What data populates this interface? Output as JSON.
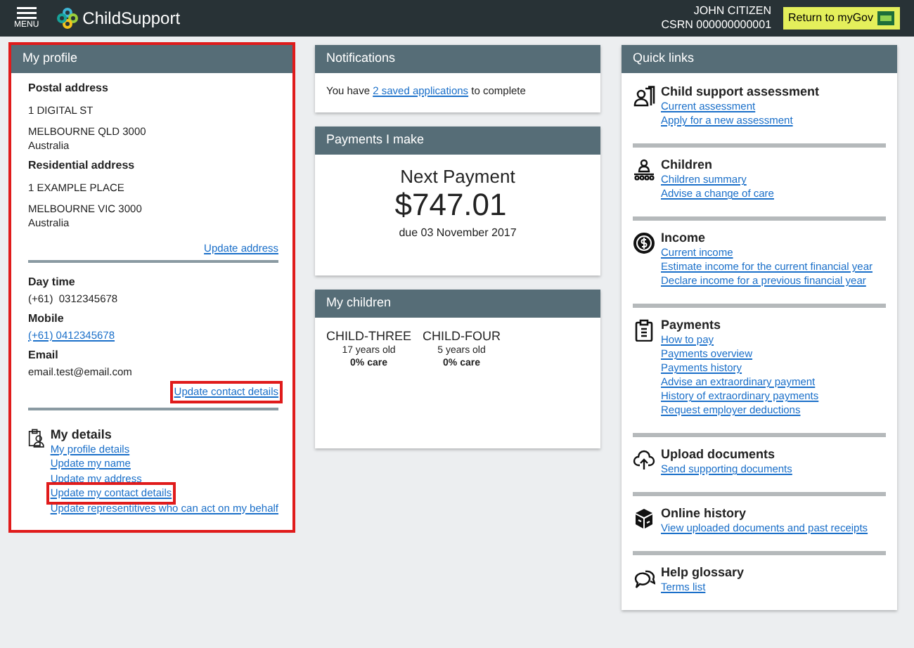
{
  "header": {
    "menu_label": "MENU",
    "brand": "ChildSupport",
    "user_name": "JOHN CITIZEN",
    "csrn": "CSRN 000000000001",
    "return_button": "Return to myGov"
  },
  "profile": {
    "title": "My profile",
    "highlighted": true,
    "postal": {
      "label": "Postal address",
      "lines": [
        "1 DIGITAL ST",
        "MELBOURNE QLD 3000",
        "Australia"
      ]
    },
    "residential": {
      "label": "Residential address",
      "lines": [
        "1 EXAMPLE PLACE",
        "MELBOURNE VIC 3000",
        "Australia"
      ]
    },
    "update_address": {
      "text": "Update address"
    },
    "contacts": [
      {
        "label": "Day time",
        "value": "(+61)  0312345678",
        "kind": "text"
      },
      {
        "label": "Mobile",
        "value": "(+61) 0412345678",
        "kind": "link"
      },
      {
        "label": "Email",
        "value": "email.test@email.com",
        "kind": "text"
      }
    ],
    "update_contact": {
      "text": "Update contact details",
      "highlighted": true
    },
    "my_details": {
      "title": "My details",
      "links": [
        {
          "text": "My profile details",
          "highlighted": false
        },
        {
          "text": "Update my name",
          "highlighted": false
        },
        {
          "text": "Update my address",
          "highlighted": false
        },
        {
          "text": "Update my contact details",
          "highlighted": true
        },
        {
          "text": "Update representitives who can act on my behalf",
          "highlighted": false
        }
      ]
    }
  },
  "notifications": {
    "title": "Notifications",
    "before": "You have ",
    "link": "2 saved applications",
    "after": " to complete"
  },
  "payments": {
    "title": "Payments I make",
    "heading": "Next Payment",
    "amount": "$747.01",
    "due": "due 03 November 2017"
  },
  "children": {
    "title": "My children",
    "items": [
      {
        "name": "CHILD-THREE",
        "age": "17 years old",
        "care": "0% care"
      },
      {
        "name": "CHILD-FOUR",
        "age": "5 years old",
        "care": "0% care"
      }
    ]
  },
  "quick_links": {
    "title": "Quick links",
    "sections": [
      {
        "title": "Child support assessment",
        "links": [
          "Current assessment",
          "Apply for a new assessment"
        ]
      },
      {
        "title": "Children",
        "links": [
          "Children summary",
          "Advise a change of care"
        ]
      },
      {
        "title": "Income",
        "links": [
          "Current income",
          "Estimate income for the current financial year",
          "Declare income for a previous financial year"
        ]
      },
      {
        "title": "Payments",
        "links": [
          "How to pay",
          "Payments overview",
          "Payments history",
          "Advise an extraordinary payment",
          "History of extraordinary payments",
          "Request employer deductions"
        ]
      },
      {
        "title": "Upload documents",
        "links": [
          "Send supporting documents"
        ]
      },
      {
        "title": "Online history",
        "links": [
          "View uploaded documents and past receipts"
        ]
      },
      {
        "title": "Help glossary",
        "links": [
          "Terms list"
        ]
      }
    ]
  }
}
